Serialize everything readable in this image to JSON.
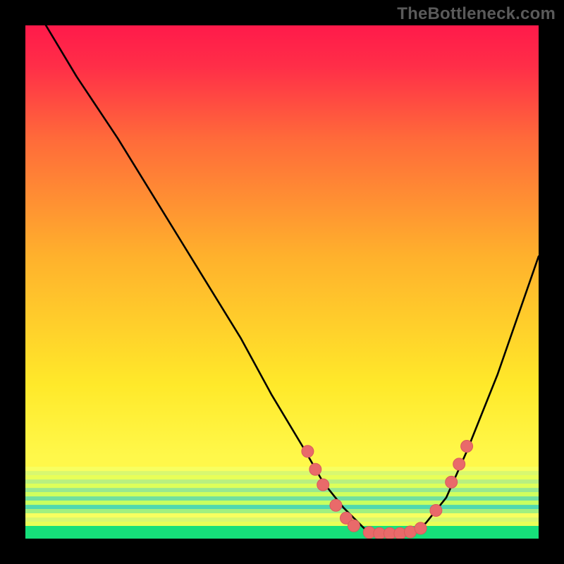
{
  "watermark": "TheBottleneck.com",
  "colors": {
    "bg_black": "#000000",
    "curve": "#000000",
    "dot_fill": "#e96a6a",
    "dot_stroke": "#d85b5b",
    "grad_top": "#ff1a4a",
    "grad_yellow": "#ffe92a",
    "grad_bottom": "#16e07a"
  },
  "chart_data": {
    "type": "line",
    "title": "",
    "xlabel": "",
    "ylabel": "",
    "xlim": [
      0,
      100
    ],
    "ylim": [
      0,
      100
    ],
    "note": "No axes or tick labels are shown; values are estimated from pixel position (x,y as percent of plot area, y=0 at bottom).",
    "series": [
      {
        "name": "curve",
        "x": [
          0,
          4,
          10,
          18,
          26,
          34,
          42,
          48,
          54,
          58,
          62,
          66,
          70,
          74,
          78,
          82,
          86,
          92,
          100
        ],
        "y": [
          108,
          100,
          90,
          78,
          65,
          52,
          39,
          28,
          18,
          11,
          6,
          2,
          1,
          1,
          3,
          8,
          17,
          32,
          55
        ]
      }
    ],
    "markers": [
      {
        "x": 55.0,
        "y": 17.0
      },
      {
        "x": 56.5,
        "y": 13.5
      },
      {
        "x": 58.0,
        "y": 10.5
      },
      {
        "x": 60.5,
        "y": 6.5
      },
      {
        "x": 62.5,
        "y": 4.0
      },
      {
        "x": 64.0,
        "y": 2.5
      },
      {
        "x": 67.0,
        "y": 1.2
      },
      {
        "x": 69.0,
        "y": 1.0
      },
      {
        "x": 71.0,
        "y": 1.0
      },
      {
        "x": 73.0,
        "y": 1.0
      },
      {
        "x": 75.0,
        "y": 1.3
      },
      {
        "x": 77.0,
        "y": 2.0
      },
      {
        "x": 80.0,
        "y": 5.5
      },
      {
        "x": 83.0,
        "y": 11.0
      },
      {
        "x": 84.5,
        "y": 14.5
      },
      {
        "x": 86.0,
        "y": 18.0
      }
    ],
    "gradient_strips": {
      "note": "Bottom ~14% of plot is horizontal yellow/green banding before solid green base.",
      "strip_top_pct": 86,
      "strip_bottom_pct": 100
    }
  }
}
